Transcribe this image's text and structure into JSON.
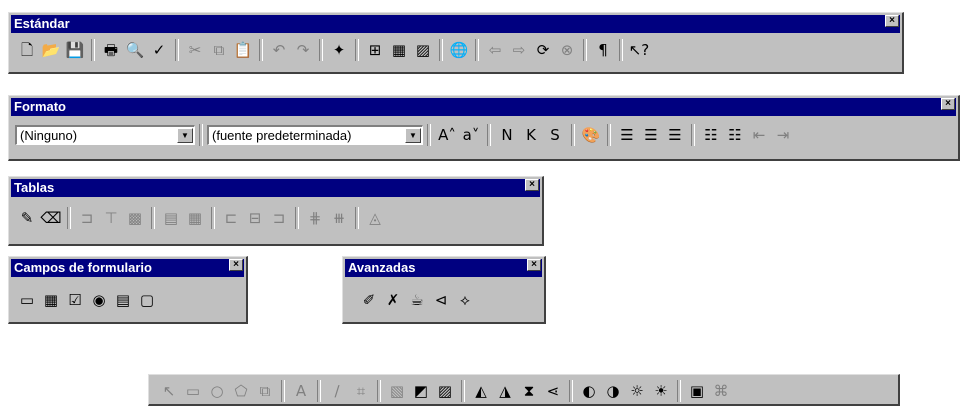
{
  "estandar": {
    "title": "Estándar",
    "close": "×",
    "buttons": [
      {
        "name": "new-document-icon",
        "glyph": "🗋"
      },
      {
        "name": "open-folder-icon",
        "glyph": "📂"
      },
      {
        "name": "save-icon",
        "glyph": "💾"
      },
      {
        "sep": true
      },
      {
        "name": "print-icon",
        "glyph": "🖶"
      },
      {
        "name": "print-preview-icon",
        "glyph": "🔍"
      },
      {
        "name": "spelling-icon",
        "glyph": "✓"
      },
      {
        "sep": true
      },
      {
        "name": "cut-icon",
        "glyph": "✂",
        "disabled": true
      },
      {
        "name": "copy-icon",
        "glyph": "⧉",
        "disabled": true
      },
      {
        "name": "paste-icon",
        "glyph": "📋"
      },
      {
        "sep": true
      },
      {
        "name": "undo-icon",
        "glyph": "↶",
        "disabled": true
      },
      {
        "name": "redo-icon",
        "glyph": "↷",
        "disabled": true
      },
      {
        "sep": true
      },
      {
        "name": "format-painter-icon",
        "glyph": "✦"
      },
      {
        "sep": true
      },
      {
        "name": "insert-hyperlink-icon",
        "glyph": "⊞"
      },
      {
        "name": "insert-table-icon",
        "glyph": "▦"
      },
      {
        "name": "insert-picture-icon",
        "glyph": "▨"
      },
      {
        "sep": true
      },
      {
        "name": "web-globe-icon",
        "glyph": "🌐"
      },
      {
        "sep": true
      },
      {
        "name": "back-arrow-icon",
        "glyph": "⇦",
        "disabled": true
      },
      {
        "name": "forward-arrow-icon",
        "glyph": "⇨",
        "disabled": true
      },
      {
        "name": "refresh-icon",
        "glyph": "⟳"
      },
      {
        "name": "stop-icon",
        "glyph": "⊗",
        "disabled": true
      },
      {
        "sep": true
      },
      {
        "name": "pilcrow-icon",
        "glyph": "¶"
      },
      {
        "sep": true
      },
      {
        "name": "help-pointer-icon",
        "glyph": "↖?"
      }
    ]
  },
  "formato": {
    "title": "Formato",
    "close": "×",
    "style_value": "(Ninguno)",
    "font_value": "(fuente predeterminada)",
    "dropdown_arrow": "▼",
    "buttons": [
      {
        "sep": true
      },
      {
        "name": "grow-font-icon",
        "glyph": "A˄"
      },
      {
        "name": "shrink-font-icon",
        "glyph": "a˅"
      },
      {
        "sep": true
      },
      {
        "name": "bold-icon",
        "glyph": "N"
      },
      {
        "name": "italic-icon",
        "glyph": "K"
      },
      {
        "name": "underline-icon",
        "glyph": "S"
      },
      {
        "sep": true
      },
      {
        "name": "font-color-icon",
        "glyph": "🎨"
      },
      {
        "sep": true
      },
      {
        "name": "align-left-icon",
        "glyph": "☰"
      },
      {
        "name": "align-center-icon",
        "glyph": "☰"
      },
      {
        "name": "align-right-icon",
        "glyph": "☰"
      },
      {
        "sep": true
      },
      {
        "name": "numbered-list-icon",
        "glyph": "☷"
      },
      {
        "name": "bulleted-list-icon",
        "glyph": "☷"
      },
      {
        "name": "decrease-indent-icon",
        "glyph": "⇤",
        "disabled": true
      },
      {
        "name": "increase-indent-icon",
        "glyph": "⇥",
        "disabled": true
      }
    ]
  },
  "tablas": {
    "title": "Tablas",
    "close": "×",
    "buttons": [
      {
        "name": "draw-table-pencil-icon",
        "glyph": "✎"
      },
      {
        "name": "eraser-icon",
        "glyph": "⌫"
      },
      {
        "sep": true
      },
      {
        "name": "insert-rows-icon",
        "glyph": "⊐",
        "disabled": true
      },
      {
        "name": "insert-columns-icon",
        "glyph": "⊤",
        "disabled": true
      },
      {
        "name": "delete-cells-icon",
        "glyph": "▩",
        "disabled": true
      },
      {
        "sep": true
      },
      {
        "name": "merge-cells-icon",
        "glyph": "▤",
        "disabled": true
      },
      {
        "name": "split-cells-icon",
        "glyph": "▦",
        "disabled": true
      },
      {
        "sep": true
      },
      {
        "name": "align-top-icon",
        "glyph": "⊏",
        "disabled": true
      },
      {
        "name": "align-middle-icon",
        "glyph": "⊟",
        "disabled": true
      },
      {
        "name": "align-bottom-icon",
        "glyph": "⊐",
        "disabled": true
      },
      {
        "sep": true
      },
      {
        "name": "distribute-rows-icon",
        "glyph": "⋕",
        "disabled": true
      },
      {
        "name": "distribute-columns-icon",
        "glyph": "⧻",
        "disabled": true
      },
      {
        "sep": true
      },
      {
        "name": "fill-color-icon",
        "glyph": "◬",
        "disabled": true
      }
    ]
  },
  "campos": {
    "title": "Campos de formulario",
    "close": "×",
    "buttons": [
      {
        "name": "text-field-icon",
        "glyph": "▭"
      },
      {
        "name": "scrolling-text-icon",
        "glyph": "▦"
      },
      {
        "name": "checkbox-icon",
        "glyph": "☑"
      },
      {
        "name": "radio-button-icon",
        "glyph": "◉"
      },
      {
        "name": "dropdown-menu-icon",
        "glyph": "▤"
      },
      {
        "name": "push-button-icon",
        "glyph": "▢"
      }
    ]
  },
  "avanzadas": {
    "title": "Avanzadas",
    "close": "×",
    "buttons": [
      {
        "name": "form-properties-icon",
        "glyph": "✐"
      },
      {
        "name": "delete-web-component-icon",
        "glyph": "✗"
      },
      {
        "name": "insert-java-icon",
        "glyph": "☕"
      },
      {
        "name": "insert-plugin-icon",
        "glyph": "⊲"
      },
      {
        "name": "insert-activex-icon",
        "glyph": "⟡"
      }
    ]
  },
  "drawing": {
    "buttons": [
      {
        "name": "select-pointer-icon",
        "glyph": "↖",
        "disabled": true
      },
      {
        "name": "rectangle-icon",
        "glyph": "▭",
        "disabled": true
      },
      {
        "name": "oval-icon",
        "glyph": "○",
        "disabled": true
      },
      {
        "name": "polygon-icon",
        "glyph": "⬠",
        "disabled": true
      },
      {
        "name": "group-icon",
        "glyph": "⧉",
        "disabled": true
      },
      {
        "sep": true
      },
      {
        "name": "text-A-icon",
        "glyph": "A",
        "disabled": true
      },
      {
        "sep": true
      },
      {
        "name": "pencil-line-icon",
        "glyph": "∕",
        "disabled": true
      },
      {
        "name": "crop-icon",
        "glyph": "⌗",
        "disabled": true
      },
      {
        "sep": true
      },
      {
        "name": "image-icon",
        "glyph": "▧",
        "disabled": true
      },
      {
        "name": "contrast-icon",
        "glyph": "◩"
      },
      {
        "name": "picture-insert-icon",
        "glyph": "▨"
      },
      {
        "sep": true
      },
      {
        "name": "rotate-left-icon",
        "glyph": "◭"
      },
      {
        "name": "rotate-right-icon",
        "glyph": "◮"
      },
      {
        "name": "flip-horizontal-icon",
        "glyph": "⧗"
      },
      {
        "name": "flip-vertical-icon",
        "glyph": "⋖"
      },
      {
        "sep": true
      },
      {
        "name": "more-contrast-icon",
        "glyph": "◐"
      },
      {
        "name": "less-contrast-icon",
        "glyph": "◑"
      },
      {
        "name": "more-brightness-icon",
        "glyph": "☼"
      },
      {
        "name": "less-brightness-icon",
        "glyph": "☀"
      },
      {
        "sep": true
      },
      {
        "name": "restore-picture-icon",
        "glyph": "▣"
      },
      {
        "name": "resample-icon",
        "glyph": "⌘",
        "disabled": true
      }
    ]
  }
}
